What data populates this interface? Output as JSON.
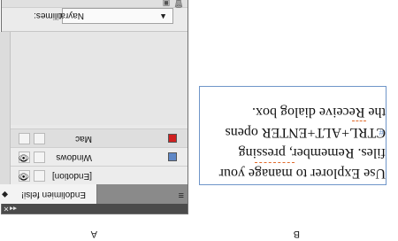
{
  "panel_a": {
    "tab_label": "Endolimien felsi!",
    "tab_arrow": "◆",
    "tab_menu_icon": "menu-icon",
    "rows": [
      {
        "name": "[Endotion]",
        "color": "",
        "visible": "👁"
      },
      {
        "name": "Windows",
        "color": "#5f87c6",
        "visible": "👁"
      },
      {
        "name": "Mac",
        "color": "#d02020",
        "visible": ""
      }
    ],
    "language_label": "Ostilimes:",
    "language_value": "Nayra",
    "language_arrow": "▲",
    "footer_icons": [
      "◂◂",
      "✕"
    ]
  },
  "panel_b": {
    "lines": [
      "Use Explorer to manage your",
      "files. Remember, pressing",
      "CTRL+ALT+ENTER opens",
      "the Receive dialog box."
    ],
    "cursor": "#"
  },
  "captions": {
    "a": "A",
    "b": "B"
  }
}
